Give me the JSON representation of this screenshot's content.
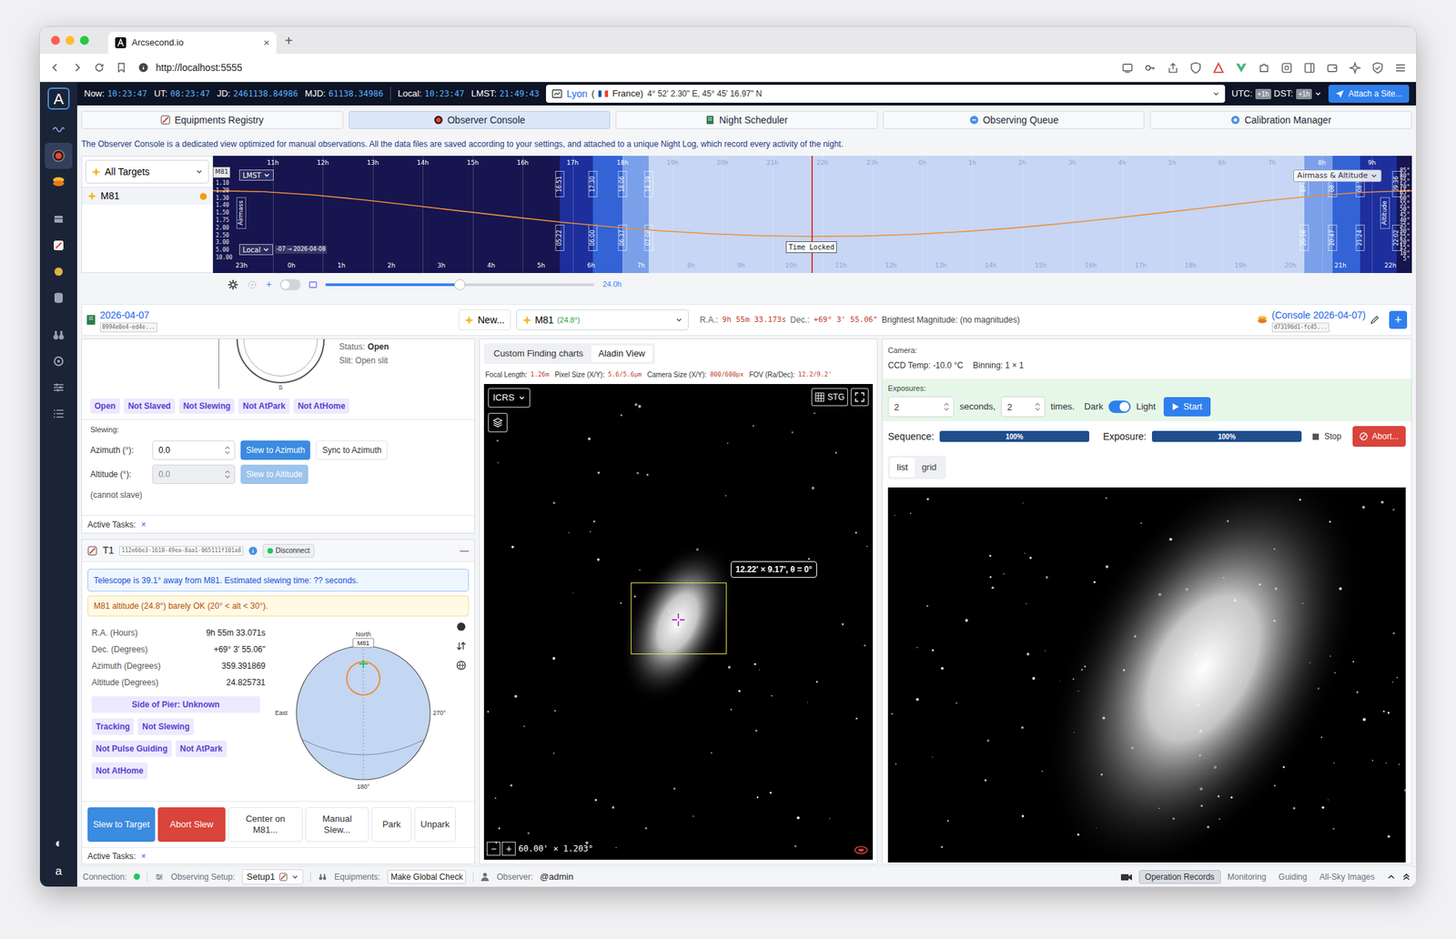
{
  "browser": {
    "tab_title": "Arcsecond.io",
    "tab_close": "×",
    "new_tab": "+",
    "url": "http://localhost:5555"
  },
  "sidebar": {
    "logo": "A",
    "items": [
      {
        "kind": "wave",
        "selected": false
      },
      {
        "kind": "console",
        "selected": true
      },
      {
        "kind": "queue",
        "selected": false
      },
      {
        "kind": "calibration",
        "selected": false
      },
      {
        "kind": "scope",
        "selected": false
      },
      {
        "kind": "planet",
        "selected": false
      },
      {
        "kind": "database",
        "selected": false
      },
      {
        "kind": "binoculars",
        "selected": false
      },
      {
        "kind": "target",
        "selected": false
      },
      {
        "kind": "sliders",
        "selected": false
      },
      {
        "kind": "list",
        "selected": false
      }
    ],
    "theme": "◐",
    "account": "a"
  },
  "topbar": {
    "clocks": [
      {
        "label": "Now:",
        "value": "10:23:47"
      },
      {
        "label": "UT:",
        "value": "08:23:47"
      },
      {
        "label": "JD:",
        "value": "2461138.84986"
      },
      {
        "label": "MJD:",
        "value": "61138.34986"
      },
      {
        "label": "Local:",
        "value": "10:23:47"
      },
      {
        "label": "LMST:",
        "value": "21:49:43"
      }
    ],
    "site": "Lyon",
    "country_open": "(",
    "country": "France)",
    "coords": "4° 52' 2.30\" E, 45° 45' 16.97\" N",
    "utc_label": "UTC:",
    "utc": "+1h",
    "dst_label": "DST:",
    "dst": "+1h",
    "attach": "Attach a Site..."
  },
  "nav": [
    {
      "label": "Equipments Registry",
      "kind": "registry",
      "selected": false
    },
    {
      "label": "Observer Console",
      "kind": "console",
      "selected": true
    },
    {
      "label": "Night Scheduler",
      "kind": "scheduler",
      "selected": false
    },
    {
      "label": "Observing Queue",
      "kind": "queue",
      "selected": false
    },
    {
      "label": "Calibration Manager",
      "kind": "calibration",
      "selected": false
    }
  ],
  "intro": "The Observer Console is a dedicated view optimized for manual observations. All the data files are saved according to your settings, and attached to a unique Night Log, which record every activity of the night.",
  "timeline": {
    "filter": "All Targets",
    "targets": [
      {
        "name": "M81",
        "color": "#f59e0b",
        "selected": true
      }
    ],
    "chart": {
      "target_label": "M81",
      "lmst_select": "LMST",
      "local_select": "Local",
      "date_range": "-07 → 2026-04-08",
      "mode_select": "Airmass & Altitude",
      "airmass_title": "Airmass",
      "altitude_title": "Altitude",
      "airmass_ticks": [
        "1.10",
        "1.20",
        "1.30",
        "1.40",
        "1.50",
        "1.75",
        "2.00",
        "2.50",
        "3.00",
        "5.00",
        "10.00"
      ],
      "altitude_ticks": [
        "85°",
        "80°",
        "75°",
        "70°",
        "65°",
        "60°",
        "55°",
        "50°",
        "45°",
        "40°",
        "35°",
        "30°",
        "25°",
        "20°",
        "15°",
        "10°",
        "5°"
      ],
      "lmst_first_at": 1.2,
      "lmst_ticks": [
        "11h",
        "12h",
        "13h",
        "14h",
        "15h",
        "16h",
        "17h",
        "18h",
        "19h",
        "20h",
        "21h",
        "22h",
        "23h",
        "0h",
        "1h",
        "2h",
        "3h",
        "4h",
        "5h",
        "6h",
        "7h",
        "8h",
        "9h"
      ],
      "local_first_at": 0.57,
      "local_ticks": [
        "23h",
        "0h",
        "1h",
        "2h",
        "3h",
        "4h",
        "5h",
        "6h",
        "7h",
        "8h",
        "9h",
        "10h",
        "11h",
        "12h",
        "13h",
        "14h",
        "15h",
        "16h",
        "17h",
        "18h",
        "19h",
        "20h",
        "21h",
        "22h"
      ],
      "bands": [
        {
          "kind": "night",
          "from": 0,
          "to": 6.94
        },
        {
          "kind": "astronomical",
          "from": 6.94,
          "to": 7.6
        },
        {
          "kind": "nautical",
          "from": 7.6,
          "to": 8.2
        },
        {
          "kind": "civil",
          "from": 8.2,
          "to": 8.72
        },
        {
          "kind": "day",
          "from": 8.72,
          "to": 21.85
        },
        {
          "kind": "civil",
          "from": 21.85,
          "to": 22.41
        },
        {
          "kind": "nautical",
          "from": 22.41,
          "to": 22.96
        },
        {
          "kind": "astronomical",
          "from": 22.96,
          "to": 23.7
        },
        {
          "kind": "night",
          "from": 23.7,
          "to": 24
        }
      ],
      "twilight": [
        {
          "at": 6.94,
          "top": "16:51",
          "bottom": "05:22"
        },
        {
          "at": 7.6,
          "top": "17:30",
          "bottom": "06:00"
        },
        {
          "at": 8.2,
          "top": "18:06",
          "bottom": "06:37"
        },
        {
          "at": 8.72,
          "top": "18:39",
          "bottom": "07:08"
        },
        {
          "at": 21.85,
          "top": "07:46",
          "bottom": "20:16"
        },
        {
          "at": 22.41,
          "top": "08:19",
          "bottom": "20:47"
        },
        {
          "at": 22.96,
          "top": "08:52",
          "bottom": "21:24"
        },
        {
          "at": 23.7,
          "top": "09:36",
          "bottom": "22:02"
        }
      ],
      "altitude": [
        66.7,
        65.8,
        62.8,
        58.4,
        53.2,
        47.9,
        42.7,
        37.8,
        33.5,
        29.9,
        27.2,
        25.5,
        24.8,
        25.2,
        26.7,
        29.2,
        32.5,
        36.6,
        41.4,
        46.5,
        51.8,
        57.1,
        61.7,
        65.2,
        66.7
      ],
      "now_at": 11.98,
      "now_label": "Time Locked"
    }
  },
  "controls": {
    "plus": "+",
    "toggle_on": false,
    "span_level": 0.5,
    "span": "24.0h"
  },
  "header": {
    "date": "2026-04-07",
    "night_log_id": "8994e0e4-ed4e...",
    "new": "New...",
    "target": "M81",
    "target_alt": "(24.8°)",
    "ra_label": "R.A.:",
    "ra": "9h 55m 33.173s",
    "dec_label": "Dec.:",
    "dec": "+69° 3' 55.06\"",
    "magnitude": "Brightest Magnitude: (no magnitudes)",
    "console": "(Console 2026-04-07)",
    "console_id": "d73196d1-fc45...",
    "add": "+"
  },
  "dome": {
    "status_label": "Status:",
    "status": "Open",
    "slit": "Slit: Open slit",
    "south": "S",
    "badges": [
      "Open",
      "Not Slaved",
      "Not Slewing",
      "Not AtPark",
      "Not AtHome"
    ],
    "slewing": "Slewing:",
    "azimuth_label": "Azimuth (°):",
    "azimuth": "0.0",
    "slew_az": "Slew to Azimuth",
    "sync_az": "Sync to Azimuth",
    "altitude_label": "Altitude (°):",
    "altitude": "0.0",
    "altitude_disabled": true,
    "slew_alt": "Slew to Altitude",
    "note": "(cannot slave)",
    "tasks": "Active Tasks:",
    "tasks_clear": "×"
  },
  "telescope": {
    "name": "T1",
    "id": "112e66e3-1610-49ea-8aa1-065111f101a8",
    "connected": true,
    "disconnect": "Disconnect",
    "collapse": "—",
    "info": "Telescope is 39.1° away from M81. Estimated slewing time: ?? seconds.",
    "warning": "M81 altitude (24.8°) barely OK (20° < alt < 30°).",
    "props": [
      {
        "label": "R.A. (Hours)",
        "value": "9h 55m 33.071s"
      },
      {
        "label": "Dec. (Degrees)",
        "value": "+69° 3' 55.06\""
      },
      {
        "label": "Azimuth (Degrees)",
        "value": "359.391869"
      },
      {
        "label": "Altitude (Degrees)",
        "value": "24.825731"
      }
    ],
    "badges": [
      "Side of Pier: Unknown",
      "Tracking",
      "Not Slewing",
      "Not Pulse Guiding",
      "Not AtPark",
      "Not AtHome"
    ],
    "dome": {
      "north": "North",
      "target": "M81",
      "east": "East",
      "west": "270°",
      "south": "180°"
    },
    "buttons": [
      {
        "label": "Slew to Target",
        "kind": "primary"
      },
      {
        "label": "Abort Slew",
        "kind": "danger"
      },
      {
        "label": "Center on M81...",
        "kind": "plain"
      },
      {
        "label": "Manual Slew...",
        "kind": "plain"
      },
      {
        "label": "Park",
        "kind": "plain"
      },
      {
        "label": "Unpark",
        "kind": "plain"
      }
    ],
    "tasks": "Active Tasks:",
    "tasks_clear": "×"
  },
  "finder": {
    "tabs": [
      {
        "label": "Custom Finding charts",
        "selected": false
      },
      {
        "label": "Aladin View",
        "selected": true
      }
    ],
    "specs": [
      {
        "label": "Focal Length:",
        "value": "1.26m"
      },
      {
        "label": "Pixel Size (X/Y):",
        "value": "5.6/5.6µm"
      },
      {
        "label": "Camera Size (X/Y):",
        "value": "800/600px"
      },
      {
        "label": "FOV (Ra/Dec):",
        "value": "12.2/9.2'"
      }
    ],
    "frame": "ICRS",
    "projection": "STG",
    "fov_label": "12.22' × 9.17', θ = 0°",
    "zoom_out": "−",
    "zoom_in": "+",
    "zoom": "60.00' × 1.203°"
  },
  "camera": {
    "title": "Camera:",
    "temp": "CCD Temp: -10.0 °C",
    "binning": "Binning: 1 × 1",
    "exposures": "Exposures:",
    "seconds_value": "2",
    "seconds": "seconds,",
    "times_value": "2",
    "times": "times.",
    "dark": "Dark",
    "light": "Light",
    "light_on": true,
    "start": "Start",
    "sequence_label": "Sequence:",
    "sequence_level": 1,
    "sequence": "100%",
    "exposure_label": "Exposure:",
    "exposure_level": 1,
    "exposure": "100%",
    "stop": "Stop",
    "abort": "Abort...",
    "views": [
      {
        "label": "list",
        "selected": true
      },
      {
        "label": "grid",
        "selected": false
      }
    ]
  },
  "statusbar": {
    "connection": "Connection:",
    "connected": true,
    "setup_label": "Observing Setup:",
    "setup": "Setup1",
    "equipments_label": "Equipments:",
    "check": "Make Global Check",
    "observer_label": "Observer:",
    "observer": "@admin",
    "tabs": [
      {
        "label": "Operation Records",
        "selected": true
      },
      {
        "label": "Monitoring",
        "selected": false
      },
      {
        "label": "Guiding",
        "selected": false
      },
      {
        "label": "All-Sky Images",
        "selected": false
      }
    ]
  }
}
